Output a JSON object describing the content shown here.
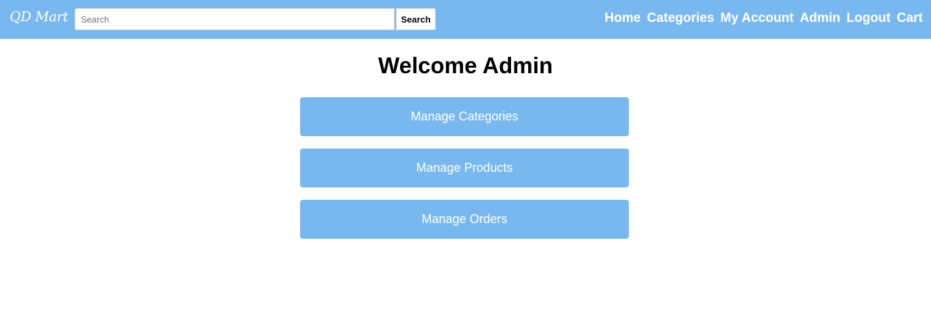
{
  "header": {
    "logo_text": "QD Mart",
    "search": {
      "placeholder": "Search",
      "value": "",
      "button_label": "Search"
    },
    "nav": {
      "home": "Home",
      "categories": "Categories",
      "my_account": "My Account",
      "admin": "Admin",
      "logout": "Logout",
      "cart": "Cart"
    }
  },
  "main": {
    "title": "Welcome Admin",
    "actions": {
      "manage_categories": "Manage Categories",
      "manage_products": "Manage Products",
      "manage_orders": "Manage Orders"
    }
  },
  "colors": {
    "accent": "#79b8ef",
    "text_on_accent": "#ffffff"
  }
}
